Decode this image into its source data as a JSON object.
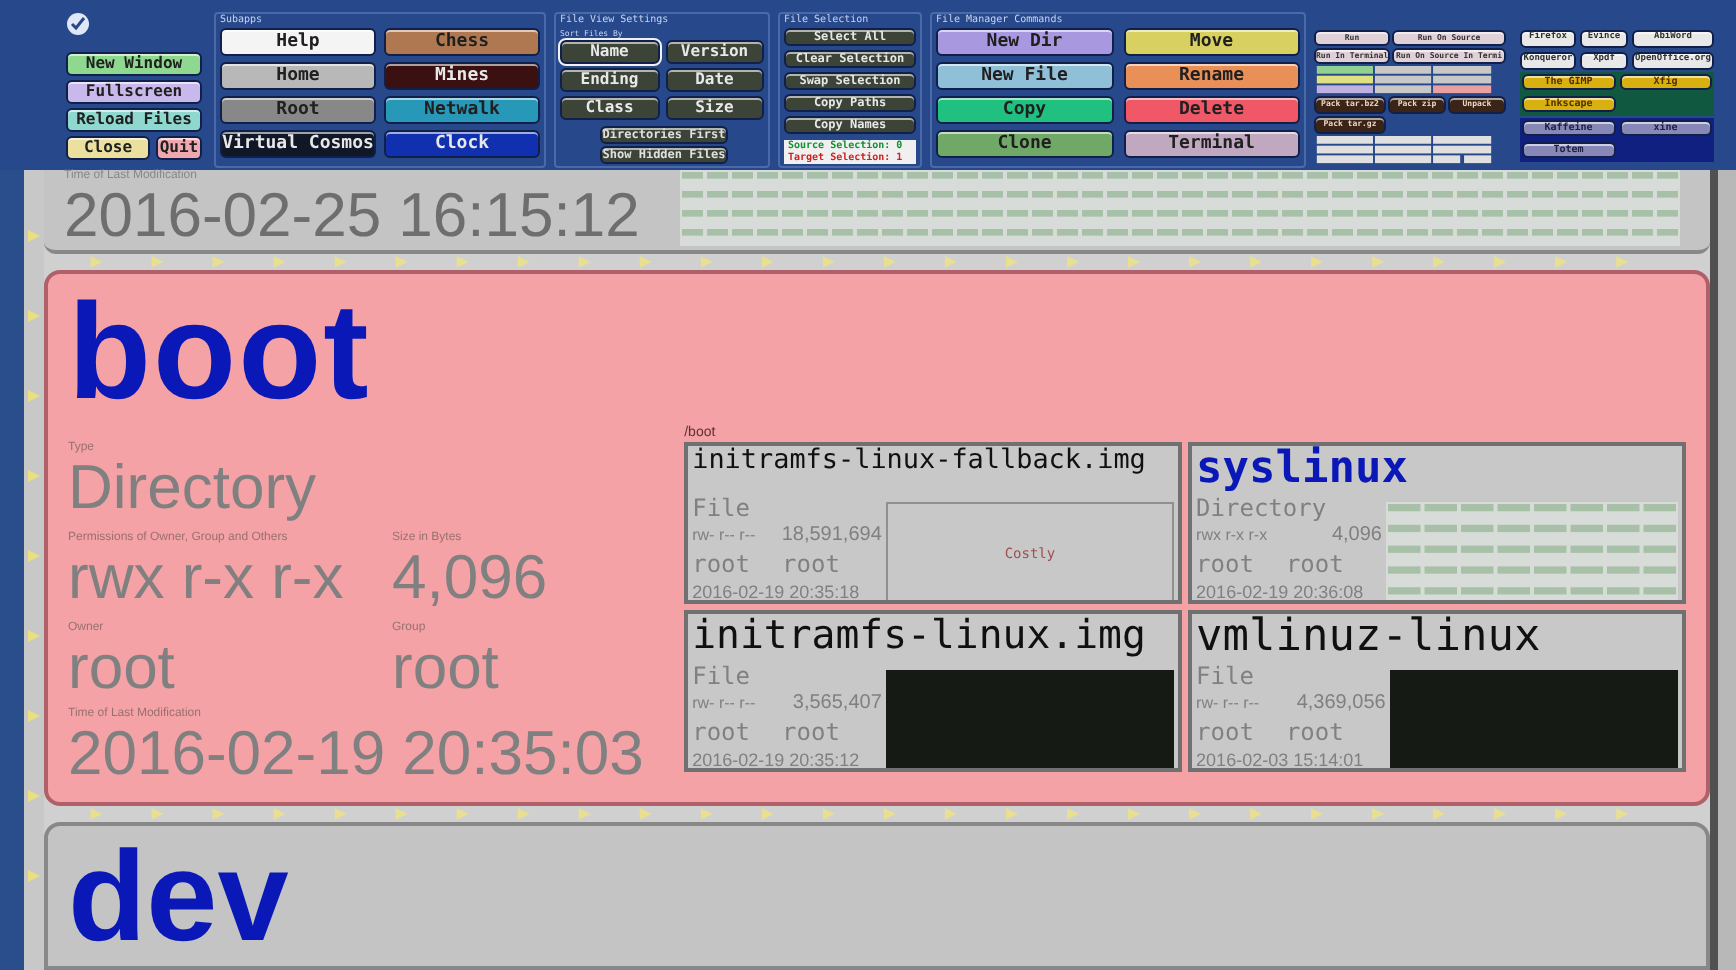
{
  "toolbar": {
    "main_commands": [
      {
        "label": "New Window",
        "color": "#8fd88f"
      },
      {
        "label": "Fullscreen",
        "color": "#c8b8ec"
      },
      {
        "label": "Reload Files",
        "color": "#8fd8d0"
      },
      {
        "label": "Close",
        "color": "#ece0a0"
      },
      {
        "label": "Quit",
        "color": "#f0a8b0"
      }
    ],
    "subapps": {
      "title": "Subapps",
      "buttons": [
        {
          "label": "Help",
          "color": "#f4f4f4"
        },
        {
          "label": "Chess",
          "color": "#b07850"
        },
        {
          "label": "Home",
          "color": "#b8b8b8"
        },
        {
          "label": "Mines",
          "color": "#3a1010"
        },
        {
          "label": "Root",
          "color": "#888888"
        },
        {
          "label": "Netwalk",
          "color": "#2898b8"
        },
        {
          "label": "Virtual Cosmos",
          "color": "#101828"
        },
        {
          "label": "Clock",
          "color": "#1030b0"
        }
      ]
    },
    "view_settings": {
      "title": "File View Settings",
      "sort_title": "Sort Files By",
      "sort_buttons": [
        {
          "label": "Name",
          "selected": true
        },
        {
          "label": "Version",
          "selected": false
        },
        {
          "label": "Ending",
          "selected": false
        },
        {
          "label": "Date",
          "selected": false
        },
        {
          "label": "Class",
          "selected": false
        },
        {
          "label": "Size",
          "selected": false
        }
      ],
      "toggles": [
        "Directories First",
        "Show Hidden Files"
      ]
    },
    "selection": {
      "title": "File Selection",
      "buttons": [
        "Select All",
        "Clear Selection",
        "Swap Selection",
        "Copy Paths",
        "Copy Names"
      ],
      "source": "Source Selection: 0",
      "target": "Target Selection: 1"
    },
    "commands": {
      "title": "File Manager Commands",
      "buttons": [
        {
          "label": "New Dir",
          "color": "#a898e0"
        },
        {
          "label": "Move",
          "color": "#d8d060"
        },
        {
          "label": "New File",
          "color": "#90c0d8"
        },
        {
          "label": "Rename",
          "color": "#e89058"
        },
        {
          "label": "Copy",
          "color": "#20c080"
        },
        {
          "label": "Delete",
          "color": "#f05868"
        },
        {
          "label": "Clone",
          "color": "#70a868"
        },
        {
          "label": "Terminal",
          "color": "#c0a8c0"
        }
      ]
    },
    "run": [
      "Run",
      "Run On Source",
      "Run In Terminal",
      "Run On Source In Termi"
    ],
    "pack": [
      "Pack tar.bz2",
      "Pack zip",
      "Unpack",
      "Pack tar.gz"
    ],
    "apps": [
      {
        "label": "Firefox",
        "color": "#e8e8e8"
      },
      {
        "label": "Evince",
        "color": "#e8e8e8"
      },
      {
        "label": "AbiWord",
        "color": "#e8e8e8"
      },
      {
        "label": "Konqueror",
        "color": "#e8e8e8"
      },
      {
        "label": "Xpdf",
        "color": "#e8e8e8"
      },
      {
        "label": "OpenOffice.org",
        "color": "#e8e8e8"
      }
    ],
    "graphics_apps": [
      "The GIMP",
      "Xfig",
      "Inkscape"
    ],
    "media_apps": [
      "Kaffeine",
      "xine",
      "Totem"
    ]
  },
  "previous_entry": {
    "time_label": "Time of Last Modification",
    "time": "2016-02-25 16:15:12"
  },
  "current_entry": {
    "name": "boot",
    "type_label": "Type",
    "type": "Directory",
    "permissions_label": "Permissions of Owner, Group and Others",
    "permissions": "rwx r-x r-x",
    "size_label": "Size in Bytes",
    "size": "4,096",
    "owner_label": "Owner",
    "owner": "root",
    "group_label": "Group",
    "group": "root",
    "time_label": "Time of Last Modification",
    "time": "2016-02-19 20:35:03",
    "path": "/boot",
    "children": [
      {
        "name": "initramfs-linux-fallback.img",
        "kind": "file",
        "type": "File",
        "permissions": "rw- r-- r--",
        "size": "18,591,694",
        "owner": "root",
        "group": "root",
        "time": "2016-02-19 20:35:18",
        "preview": {
          "kind": "text",
          "text": "Costly"
        }
      },
      {
        "name": "syslinux",
        "kind": "directory",
        "type": "Directory",
        "permissions": "rwx r-x r-x",
        "size": "4,096",
        "owner": "root",
        "group": "root",
        "time": "2016-02-19 20:36:08",
        "preview": {
          "kind": "grid"
        }
      },
      {
        "name": "initramfs-linux.img",
        "kind": "file",
        "type": "File",
        "permissions": "rw- r-- r--",
        "size": "3,565,407",
        "owner": "root",
        "group": "root",
        "time": "2016-02-19 20:35:12",
        "preview": {
          "kind": "dark"
        }
      },
      {
        "name": "vmlinuz-linux",
        "kind": "file",
        "type": "File",
        "permissions": "rw- r-- r--",
        "size": "4,369,056",
        "owner": "root",
        "group": "root",
        "time": "2016-02-03 15:14:01",
        "preview": {
          "kind": "dark"
        }
      }
    ]
  },
  "next_entry": {
    "name": "dev"
  }
}
